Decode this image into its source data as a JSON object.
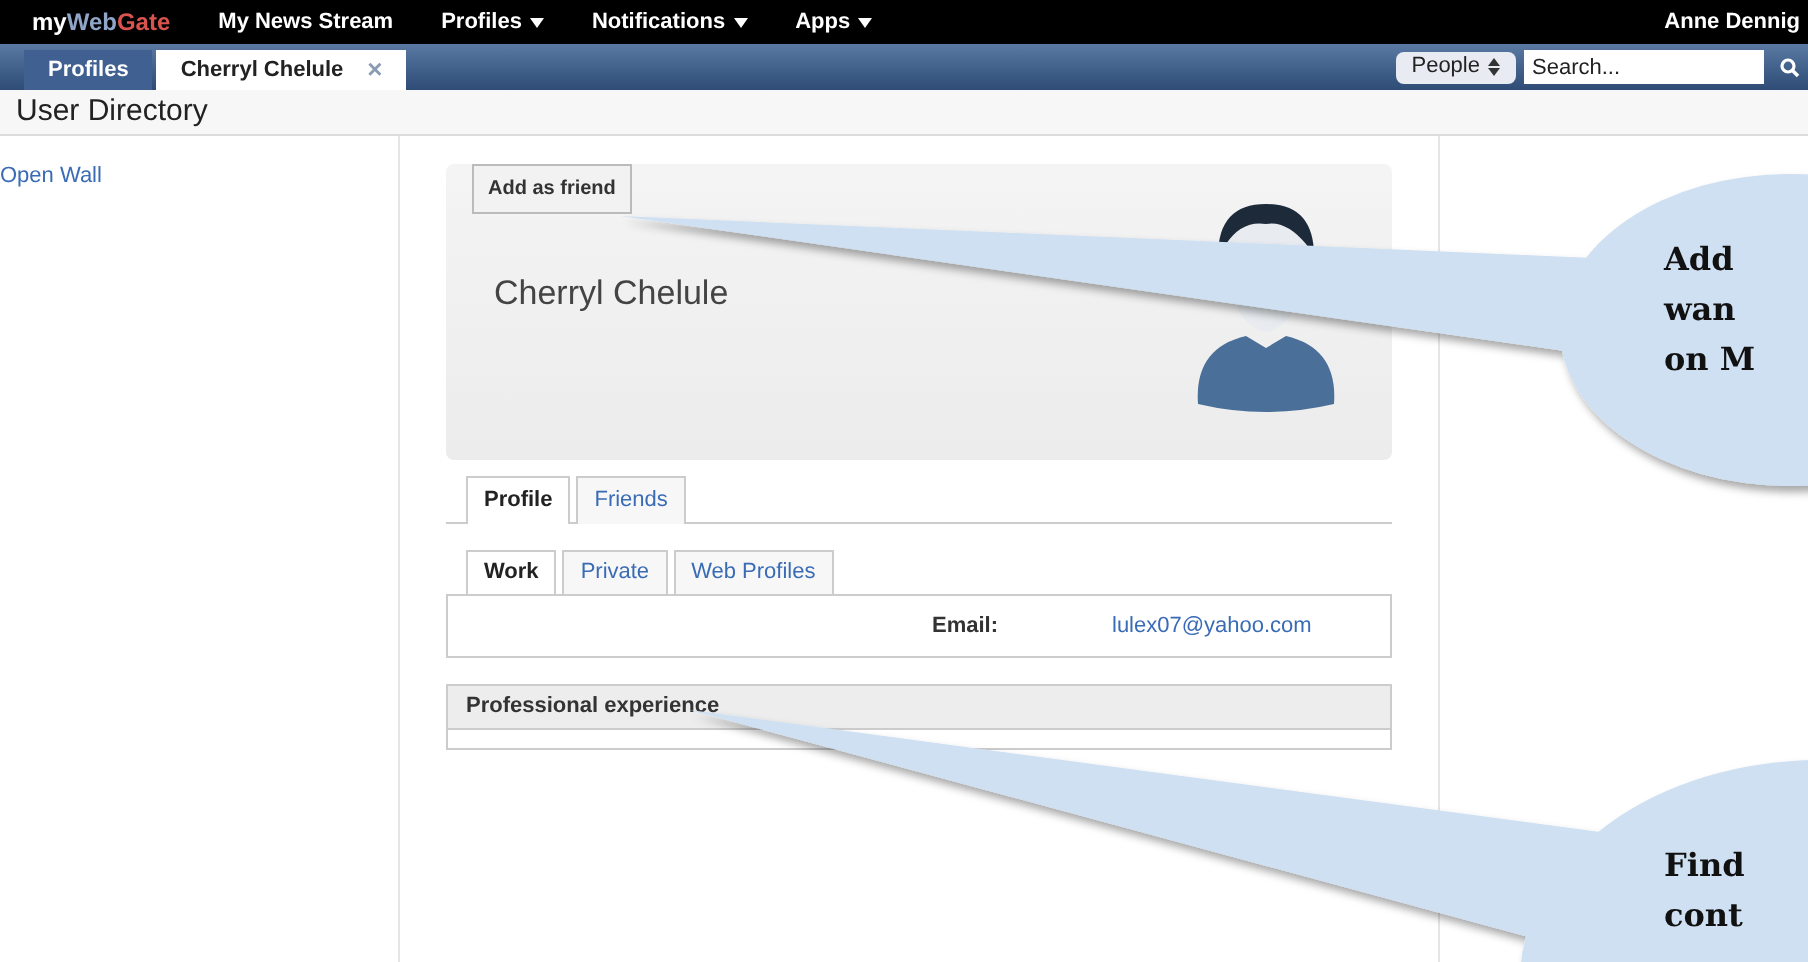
{
  "top_nav": {
    "logo": [
      {
        "text": "my",
        "color": "#ffffff"
      },
      {
        "text": "Web",
        "color": "#8fa6c8"
      },
      {
        "text": "Gate",
        "color": "#d9534f"
      }
    ],
    "items": [
      {
        "label": "My News Stream",
        "dropdown": false
      },
      {
        "label": "Profiles",
        "dropdown": true
      },
      {
        "label": "Notifications",
        "dropdown": true
      },
      {
        "label": "Apps",
        "dropdown": true
      }
    ],
    "user": "Anne Dennig"
  },
  "tab_bar": {
    "tabs": [
      {
        "label": "Profiles",
        "selected": false,
        "closable": false
      },
      {
        "label": "Cherryl Chelule",
        "selected": true,
        "closable": true,
        "close": "×"
      }
    ],
    "search_scope": "People",
    "search": {
      "placeholder": "Search..."
    }
  },
  "page_title": "User Directory",
  "sidebar": {
    "links": [
      "Open Wall"
    ]
  },
  "profile": {
    "add_button": "Add as friend",
    "name": "Cherryl Chelule",
    "tabs": [
      {
        "label": "Profile",
        "selected": true
      },
      {
        "label": "Friends",
        "selected": false
      }
    ],
    "subtabs": [
      {
        "label": "Work",
        "selected": true
      },
      {
        "label": "Private",
        "selected": false
      },
      {
        "label": "Web Profiles",
        "selected": false
      }
    ],
    "fields": [
      {
        "label": "Email:",
        "value": "lulex07@yahoo.com"
      }
    ],
    "sections": [
      "Professional experience"
    ]
  },
  "callouts": [
    {
      "lines": [
        "Add",
        "wan",
        "on M"
      ]
    },
    {
      "lines": [
        "Find",
        "cont"
      ]
    }
  ]
}
